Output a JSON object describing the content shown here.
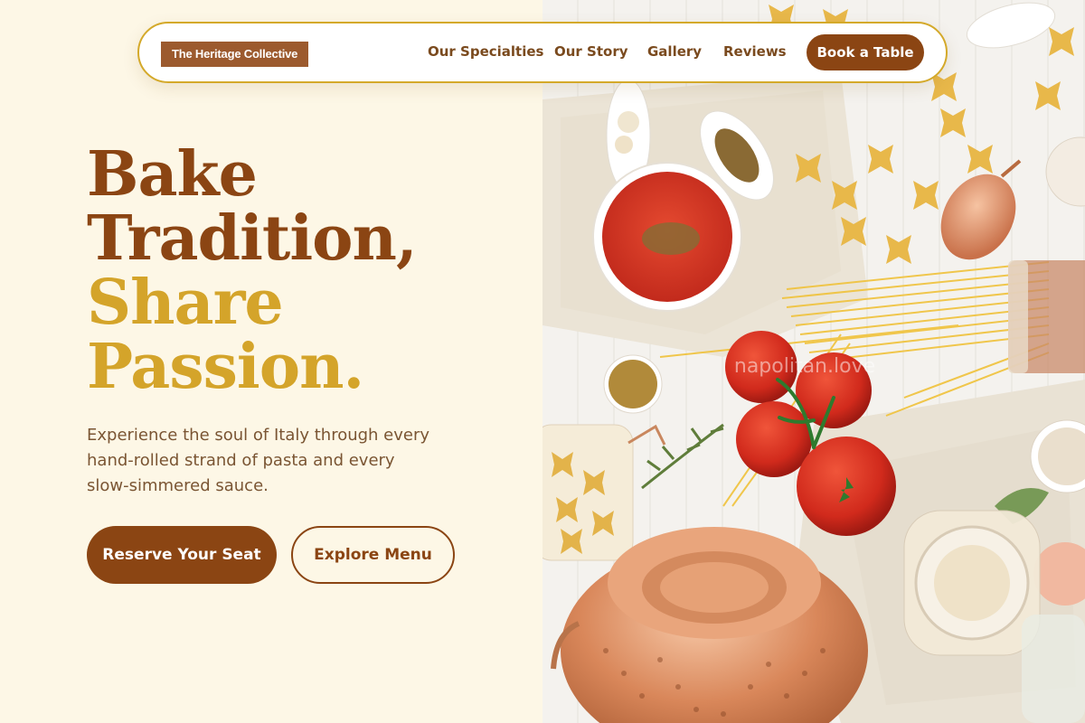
{
  "brand": {
    "name": "The Heritage Collective"
  },
  "nav": {
    "links": [
      "Our Specialties",
      "Our Story",
      "Gallery",
      "Reviews"
    ],
    "cta": "Book a Table"
  },
  "hero": {
    "headline": [
      "Bake",
      "Tradition,",
      "Share",
      "Passion."
    ],
    "subtext": "Experience the soul of Italy through every hand-rolled strand of pasta and every slow-simmered sauce.",
    "primary_button": "Reserve Your Seat",
    "secondary_button": "Explore Menu"
  },
  "image": {
    "watermark": "napolitan.love"
  },
  "colors": {
    "background": "#fdf7e6",
    "brown": "#8b4513",
    "gold": "#d4a42a",
    "logo_bg": "#9c5a2e"
  }
}
